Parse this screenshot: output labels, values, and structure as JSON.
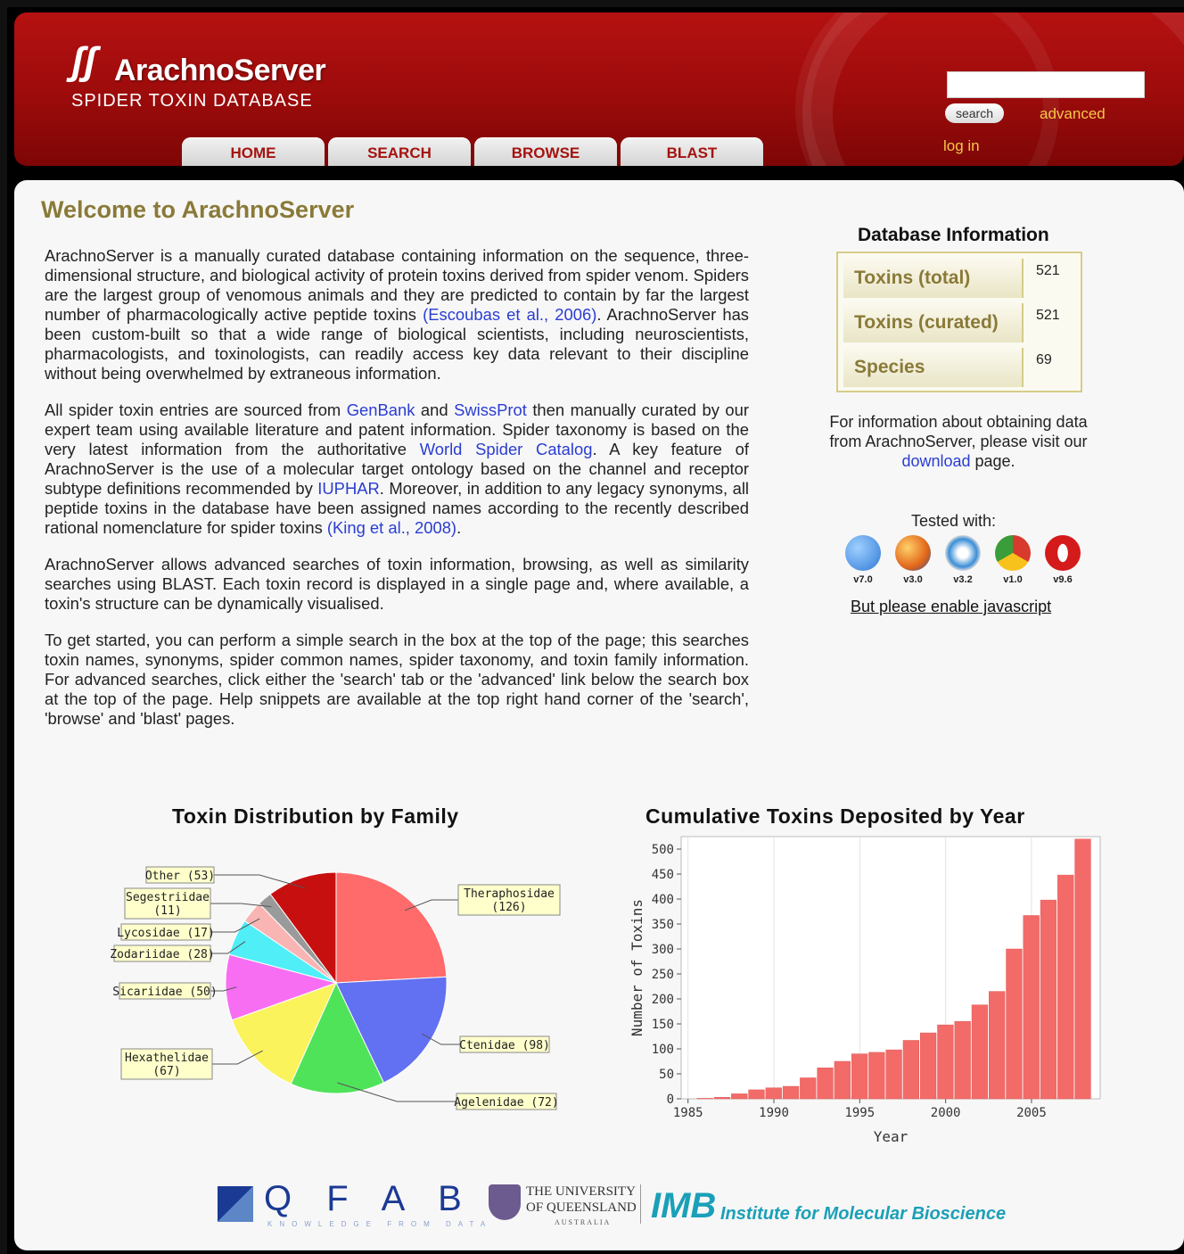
{
  "header": {
    "logo_mark": "⸗",
    "logo_title": "ArachnoServer",
    "logo_subtitle": "SPIDER TOXIN DATABASE",
    "nav_tabs": [
      "HOME",
      "SEARCH",
      "BROWSE",
      "BLAST"
    ],
    "search_value": "",
    "search_button": "search",
    "advanced_link": "advanced",
    "login_link": "log in"
  },
  "main": {
    "title": "Welcome to ArachnoServer",
    "p1": {
      "a": "ArachnoServer is a manually curated database containing information on the sequence, three-dimensional structure, and biological activity of protein toxins derived from spider venom. Spiders are the largest group of venomous animals and they are predicted to contain by far the largest number of pharmacologically active peptide toxins ",
      "link": "(Escoubas et al., 2006)",
      "b": ". ArachnoServer has been custom-built so that a wide range of biological scientists, including neuroscientists, pharmacologists, and toxinologists, can readily access key data relevant to their discipline without being overwhelmed by extraneous information."
    },
    "p2": {
      "a": "All spider toxin entries are sourced from ",
      "link1": "GenBank",
      "b": " and ",
      "link2": "SwissProt",
      "c": " then manually curated by our expert team using available literature and patent information. Spider taxonomy is based on the very latest information from the authoritative ",
      "link3": "World Spider Catalog",
      "d": ". A key feature of ArachnoServer is the use of a molecular target ontology based on the channel and receptor subtype definitions recommended by ",
      "link4": "IUPHAR",
      "e": ". Moreover, in addition to any legacy synonyms, all peptide toxins in the database have been assigned names according to the recently described rational nomenclature for spider toxins ",
      "link5": "(King et al., 2008)",
      "f": "."
    },
    "p3": "ArachnoServer allows advanced searches of toxin information, browsing, as well as similarity searches using BLAST. Each toxin record is displayed in a single page and, where available, a toxin's structure can be dynamically visualised.",
    "p4": "To get started, you can perform a simple search in the box at the top of the page; this searches toxin names, synonyms, spider common names, spider taxonomy, and toxin family information. For advanced searches, click either the 'search' tab or the 'advanced' link below the search box at the top of the page. Help snippets are available at the top right hand corner of the 'search', 'browse' and 'blast' pages."
  },
  "sidebar": {
    "db_title": "Database Information",
    "rows": [
      {
        "label": "Toxins (total)",
        "value": "521"
      },
      {
        "label": "Toxins (curated)",
        "value": "521"
      },
      {
        "label": "Species",
        "value": "69"
      }
    ],
    "download_text_a": "For information about obtaining data from ArachnoServer, please visit our ",
    "download_link": "download",
    "download_text_b": " page.",
    "tested_with": "Tested with:",
    "browsers": [
      {
        "name": "ie-icon",
        "version": "v7.0",
        "color": "#2f79d6"
      },
      {
        "name": "firefox-icon",
        "version": "v3.0",
        "color": "#e2661a"
      },
      {
        "name": "safari-icon",
        "version": "v3.2",
        "color": "#3a8ed6"
      },
      {
        "name": "chrome-icon",
        "version": "v1.0",
        "color": "#3a9d3a"
      },
      {
        "name": "opera-icon",
        "version": "v9.6",
        "color": "#d41a1a"
      }
    ],
    "enable_js": "But please enable javascript"
  },
  "chart_data": [
    {
      "type": "pie",
      "title": "Toxin Distribution by Family",
      "slices": [
        {
          "label": "Theraphosidae",
          "value": 126,
          "color": "#ff6b6b"
        },
        {
          "label": "Ctenidae",
          "value": 98,
          "color": "#6270f2"
        },
        {
          "label": "Agelenidae",
          "value": 72,
          "color": "#4fe35a"
        },
        {
          "label": "Hexathelidae",
          "value": 67,
          "color": "#fbf35c"
        },
        {
          "label": "Sicariidae",
          "value": 50,
          "color": "#f76ef2"
        },
        {
          "label": "Zodariidae",
          "value": 28,
          "color": "#50eef7"
        },
        {
          "label": "Lycosidae",
          "value": 17,
          "color": "#f9b4b4"
        },
        {
          "label": "Segestriidae",
          "value": 11,
          "color": "#9a9a9a"
        },
        {
          "label": "Other",
          "value": 53,
          "color": "#c80f0f"
        }
      ]
    },
    {
      "type": "bar",
      "title": "Cumulative Toxins Deposited by Year",
      "xlabel": "Year",
      "ylabel": "Number of Toxins",
      "ylim": [
        0,
        525
      ],
      "yticks": [
        0,
        50,
        100,
        150,
        200,
        250,
        300,
        350,
        400,
        450,
        500
      ],
      "xticks": [
        1985,
        1990,
        1995,
        2000,
        2005
      ],
      "bar_color": "#f26b68",
      "categories": [
        1985,
        1986,
        1987,
        1988,
        1989,
        1990,
        1991,
        1992,
        1993,
        1994,
        1995,
        1996,
        1997,
        1998,
        1999,
        2000,
        2001,
        2002,
        2003,
        2004,
        2005,
        2006,
        2007,
        2008
      ],
      "values": [
        0,
        1,
        3,
        10,
        18,
        22,
        25,
        42,
        62,
        75,
        90,
        93,
        98,
        117,
        132,
        148,
        155,
        188,
        215,
        300,
        367,
        398,
        448,
        520
      ]
    }
  ],
  "footer": {
    "qfab": "Q F A B",
    "qfab_sub": "KNOWLEDGE FROM DATA",
    "uq_line1": "THE UNIVERSITY",
    "uq_line2": "OF QUEENSLAND",
    "uq_line3": "AUSTRALIA",
    "imb": "IMB",
    "imb_full": "Institute for Molecular Bioscience"
  }
}
